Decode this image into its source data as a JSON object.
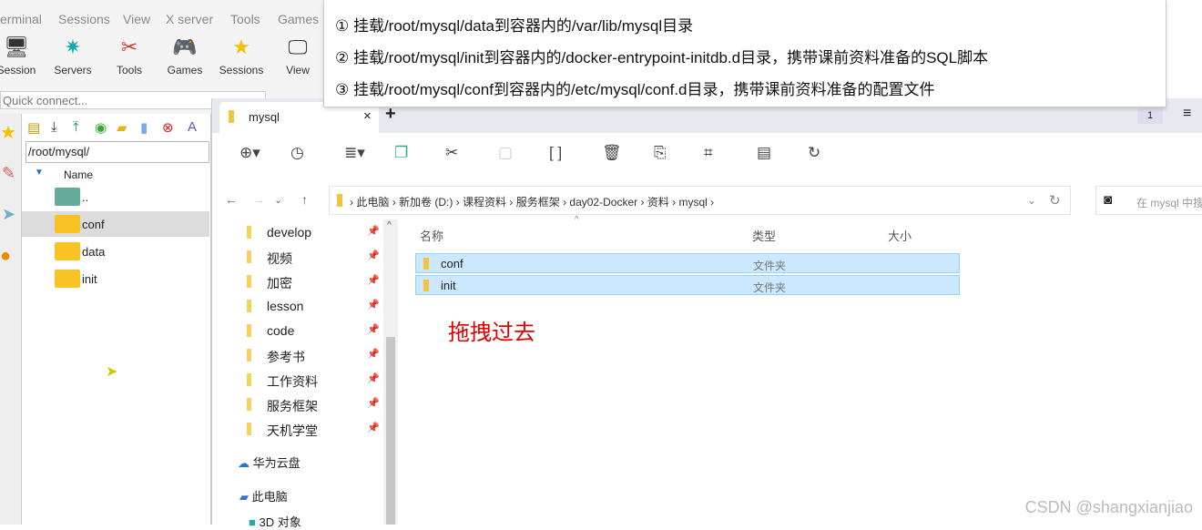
{
  "moba": {
    "menu": [
      "erminal",
      "Sessions",
      "View",
      "X server",
      "Tools",
      "Games"
    ],
    "toolbar": [
      {
        "label": "Session",
        "icon": "monitor-icon"
      },
      {
        "label": "Servers",
        "icon": "network-icon"
      },
      {
        "label": "Tools",
        "icon": "tools-icon"
      },
      {
        "label": "Games",
        "icon": "gamepad-icon"
      },
      {
        "label": "Sessions",
        "icon": "star-icon"
      },
      {
        "label": "View",
        "icon": "view-icon"
      }
    ],
    "quick_connect_placeholder": "Quick connect...",
    "path": "/root/mysql/",
    "name_header": "Name",
    "files": [
      "..",
      "conf",
      "data",
      "init"
    ]
  },
  "callout": {
    "lines": [
      "① 挂载/root/mysql/data到容器内的/var/lib/mysql目录",
      "② 挂载/root/mysql/init到容器内的/docker-entrypoint-initdb.d目录，携带课前资料准备的SQL脚本",
      "③ 挂载/root/mysql/conf到容器内的/etc/mysql/conf.d目录，携带课前资料准备的配置文件"
    ]
  },
  "explorer": {
    "tab_title": "mysql",
    "tab_close": "×",
    "new_tab": "+",
    "count_badge": "1",
    "breadcrumb": [
      "此电脑",
      "新加卷 (D:)",
      "课程资料",
      "服务框架",
      "day02-Docker",
      "资料",
      "mysql"
    ],
    "search_placeholder": "在 mysql 中搜",
    "nav": [
      "develop",
      "视频",
      "加密",
      "lesson",
      "code",
      "参考书",
      "工作资料",
      "服务框架",
      "天机学堂"
    ],
    "cloud": "华为云盘",
    "pc": "此电脑",
    "objects3d": "3D 对象",
    "columns": {
      "name": "名称",
      "type": "类型",
      "size": "大小"
    },
    "rows": [
      {
        "name": "conf",
        "type": "文件夹"
      },
      {
        "name": "init",
        "type": "文件夹"
      }
    ]
  },
  "annotation": "拖拽过去",
  "watermark": "CSDN @shangxianjiao",
  "colors": {
    "selection": "#cce8ff",
    "folder": "#f7c325",
    "annotation": "#e00000"
  }
}
